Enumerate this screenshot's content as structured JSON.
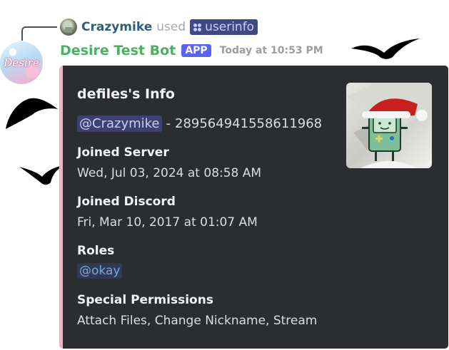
{
  "reply": {
    "username": "Crazymike",
    "used_text": "used",
    "command": "userinfo",
    "command_icon": "slash-command-icon"
  },
  "message": {
    "bot_name": "Desire Test Bot",
    "badge": "APP",
    "timestamp": "Today at 10:53 PM",
    "avatar_text": "Desire"
  },
  "embed": {
    "accent_color": "#f2b3c0",
    "title": "defiles's Info",
    "mention": "@Crazymike",
    "user_id_separator": "-",
    "user_id": "289564941558611968",
    "fields": [
      {
        "name": "Joined Server",
        "value": "Wed, Jul 03, 2024 at 08:58 AM"
      },
      {
        "name": "Joined Discord",
        "value": "Fri, Mar 10, 2017 at 01:07 AM"
      },
      {
        "name": "Roles",
        "value": "@okay"
      },
      {
        "name": "Special Permissions",
        "value": "Attach Files, Change Nickname, Stream"
      }
    ],
    "thumbnail": "bmo-santa-hat-avatar"
  },
  "colors": {
    "bot_name": "#4caf62",
    "app_badge": "#5865f2",
    "embed_bg": "#2b2d31"
  }
}
